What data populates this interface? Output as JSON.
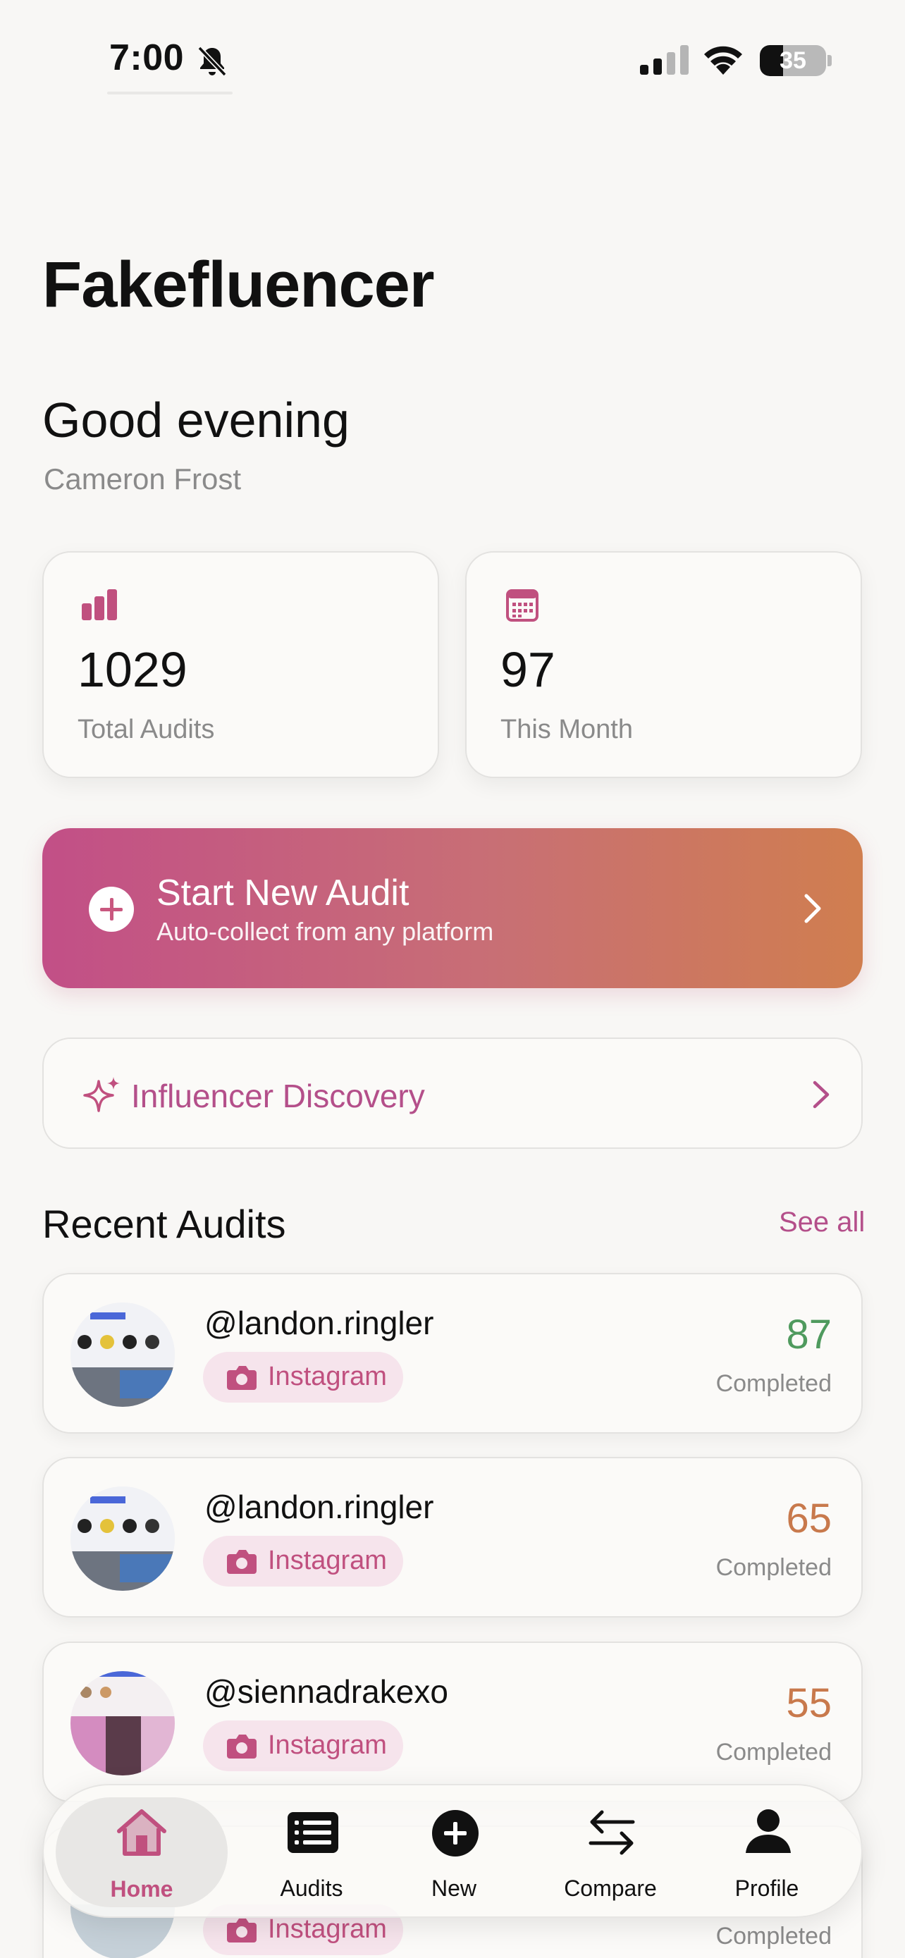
{
  "status_bar": {
    "time": "7:00",
    "battery": "35",
    "battery_percent": 35
  },
  "app": {
    "title": "Fakefluencer"
  },
  "greeting": {
    "text": "Good evening",
    "user_name": "Cameron Frost"
  },
  "stats": [
    {
      "icon": "bar-chart-icon",
      "value": "1029",
      "label": "Total Audits"
    },
    {
      "icon": "calendar-icon",
      "value": "97",
      "label": "This Month"
    }
  ],
  "new_audit": {
    "title": "Start New Audit",
    "subtitle": "Auto-collect from any platform"
  },
  "discovery": {
    "label": "Influencer Discovery"
  },
  "recent": {
    "title": "Recent Audits",
    "see_all": "See all",
    "items": [
      {
        "handle": "@landon.ringler",
        "platform": "Instagram",
        "score": "87",
        "status": "Completed",
        "score_color": "#4f9a5e"
      },
      {
        "handle": "@landon.ringler",
        "platform": "Instagram",
        "score": "65",
        "status": "Completed",
        "score_color": "#c8794c"
      },
      {
        "handle": "@siennadrakexo",
        "platform": "Instagram",
        "score": "55",
        "status": "Completed",
        "score_color": "#c8794c"
      },
      {
        "handle": "",
        "platform": "Instagram",
        "score": "",
        "status": "Completed",
        "score_color": "#4f9a5e"
      }
    ]
  },
  "tabs": [
    {
      "label": "Home",
      "icon": "home-icon",
      "active": true
    },
    {
      "label": "Audits",
      "icon": "list-icon",
      "active": false
    },
    {
      "label": "New",
      "icon": "plus-circle-icon",
      "active": false
    },
    {
      "label": "Compare",
      "icon": "swap-arrows-icon",
      "active": false
    },
    {
      "label": "Profile",
      "icon": "person-icon",
      "active": false
    }
  ],
  "colors": {
    "accent": "#c0507f",
    "gradient_start": "#c24f87",
    "gradient_end": "#d07e4f",
    "score_good": "#4f9a5e",
    "score_mid": "#c8794c"
  }
}
